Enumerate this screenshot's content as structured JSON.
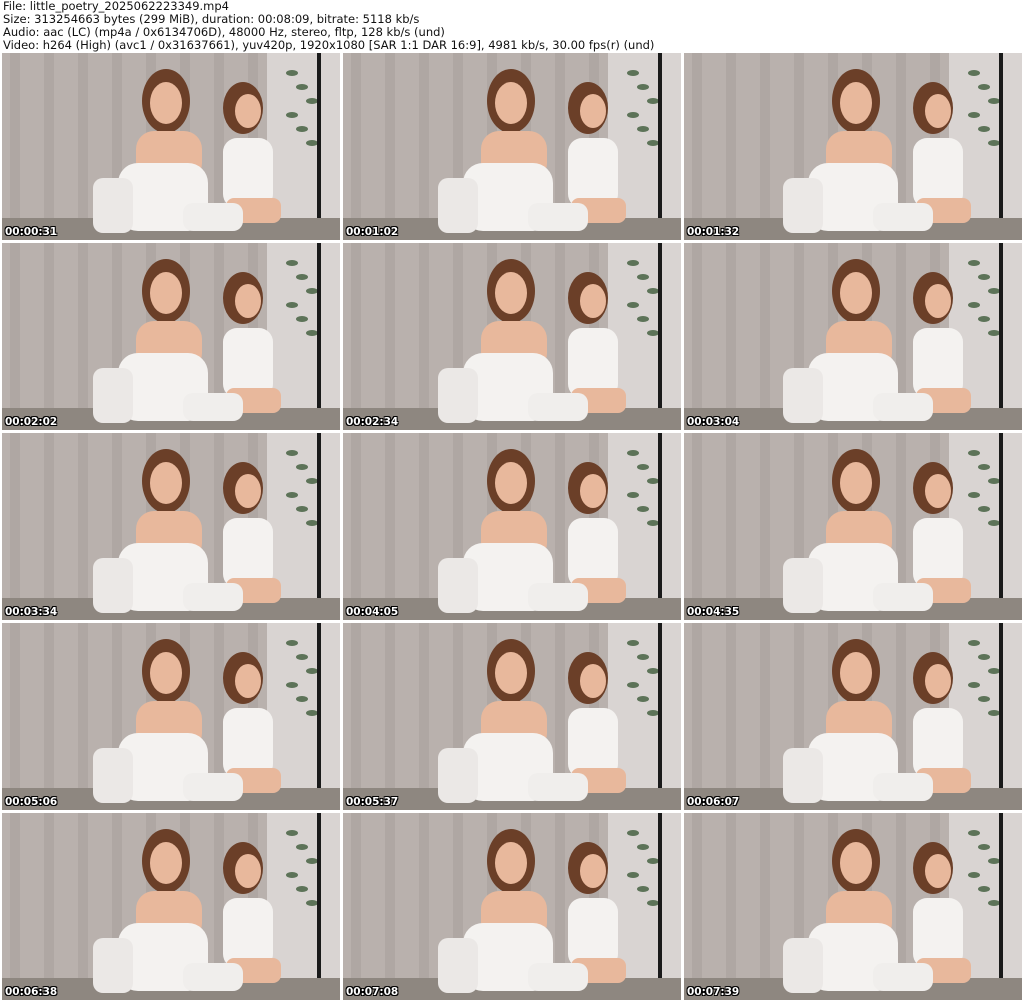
{
  "header": {
    "file": "File: little_poetry_2025062223349.mp4",
    "size": "Size: 313254663 bytes (299 MiB), duration: 00:08:09, bitrate: 5118 kb/s",
    "audio": "Audio: aac (LC) (mp4a / 0x6134706D), 48000 Hz, stereo, fltp, 128 kb/s (und)",
    "video": "Video: h264 (High) (avc1 / 0x31637661), yuv420p, 1920x1080 [SAR 1:1 DAR 16:9], 4981 kb/s, 30.00 fps(r) (und)"
  },
  "thumbnails": [
    {
      "timestamp": "00:00:31"
    },
    {
      "timestamp": "00:01:02"
    },
    {
      "timestamp": "00:01:32"
    },
    {
      "timestamp": "00:02:02"
    },
    {
      "timestamp": "00:02:34"
    },
    {
      "timestamp": "00:03:04"
    },
    {
      "timestamp": "00:03:34"
    },
    {
      "timestamp": "00:04:05"
    },
    {
      "timestamp": "00:04:35"
    },
    {
      "timestamp": "00:05:06"
    },
    {
      "timestamp": "00:05:37"
    },
    {
      "timestamp": "00:06:07"
    },
    {
      "timestamp": "00:06:38"
    },
    {
      "timestamp": "00:07:08"
    },
    {
      "timestamp": "00:07:39"
    }
  ],
  "colors": {
    "background": "#ffffff",
    "curtain": "#b9b1ad",
    "curtain_dark": "#9e9591",
    "skin": "#e8b89c",
    "hair": "#6b3f28",
    "pillow": "#f4f2f0",
    "mirror_frame": "#1a1a1a"
  }
}
